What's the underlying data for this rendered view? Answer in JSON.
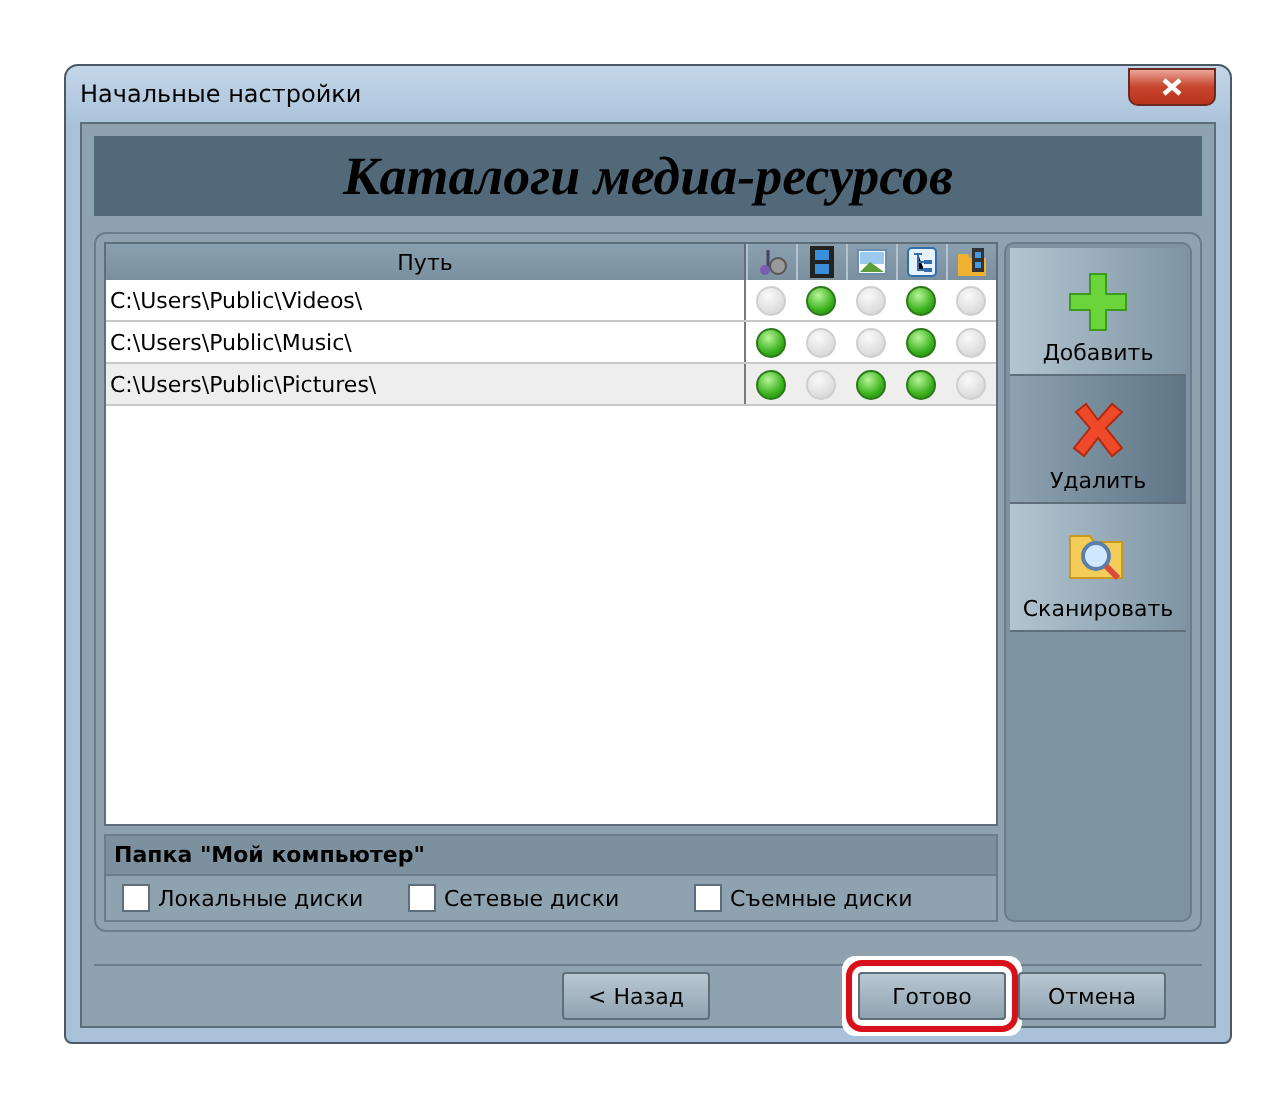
{
  "window": {
    "title": "Начальные настройки"
  },
  "banner": "Каталоги медиа-ресурсов",
  "table": {
    "columns": [
      {
        "label": "Путь",
        "kind": "text"
      },
      {
        "kind": "music"
      },
      {
        "kind": "video"
      },
      {
        "kind": "image"
      },
      {
        "kind": "tree"
      },
      {
        "kind": "folder"
      }
    ],
    "rows": [
      {
        "path": "C:\\Users\\Public\\Videos\\",
        "flags": [
          false,
          true,
          false,
          true,
          false
        ],
        "selected": false
      },
      {
        "path": "C:\\Users\\Public\\Music\\",
        "flags": [
          true,
          false,
          false,
          true,
          false
        ],
        "selected": false
      },
      {
        "path": "C:\\Users\\Public\\Pictures\\",
        "flags": [
          true,
          false,
          true,
          true,
          false
        ],
        "selected": true
      }
    ]
  },
  "side_buttons": [
    {
      "label": "Добавить",
      "kind": "add",
      "selected": false
    },
    {
      "label": "Удалить",
      "kind": "delete",
      "selected": true
    },
    {
      "label": "Сканировать",
      "kind": "scan",
      "selected": false
    }
  ],
  "my_computer": {
    "title": "Папка \"Мой компьютер\"",
    "options": [
      {
        "label": "Локальные диски",
        "checked": false
      },
      {
        "label": "Сетевые диски",
        "checked": false
      },
      {
        "label": "Съемные диски",
        "checked": false
      }
    ]
  },
  "buttons": [
    {
      "label": "< Назад",
      "highlighted": false
    },
    {
      "label": "Готово",
      "highlighted": true
    },
    {
      "label": "Отмена",
      "highlighted": false
    }
  ]
}
